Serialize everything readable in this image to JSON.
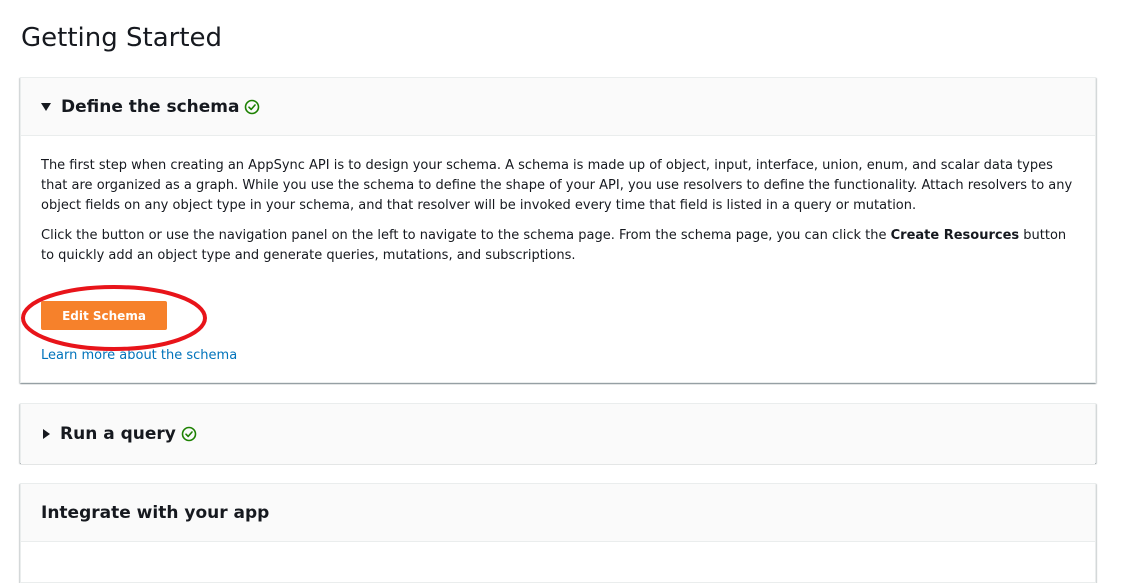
{
  "page": {
    "title": "Getting Started"
  },
  "sections": {
    "define_schema": {
      "title": "Define the schema",
      "expanded": true,
      "completed": true,
      "paragraph1": "The first step when creating an AppSync API is to design your schema. A schema is made up of object, input, interface, union, enum, and scalar data types that are organized as a graph. While you use the schema to define the shape of your API, you use resolvers to define the functionality. Attach resolvers to any object fields on any object type in your schema, and that resolver will be invoked every time that field is listed in a query or mutation.",
      "paragraph2_before": "Click the button or use the navigation panel on the left to navigate to the schema page. From the schema page, you can click the ",
      "paragraph2_bold": "Create Resources",
      "paragraph2_after": " button to quickly add an object type and generate queries, mutations, and subscriptions.",
      "button_label": "Edit Schema",
      "link_label": "Learn more about the schema"
    },
    "run_query": {
      "title": "Run a query",
      "expanded": false,
      "completed": true
    },
    "integrate": {
      "title": "Integrate with your app"
    }
  },
  "colors": {
    "accent_button": "#f6812b",
    "link": "#0073bb",
    "success": "#1d8102",
    "annotation": "#e8141a"
  },
  "icons": {
    "expanded_caret": "caret-down-icon",
    "collapsed_caret": "caret-right-icon",
    "status": "check-circle-icon"
  }
}
